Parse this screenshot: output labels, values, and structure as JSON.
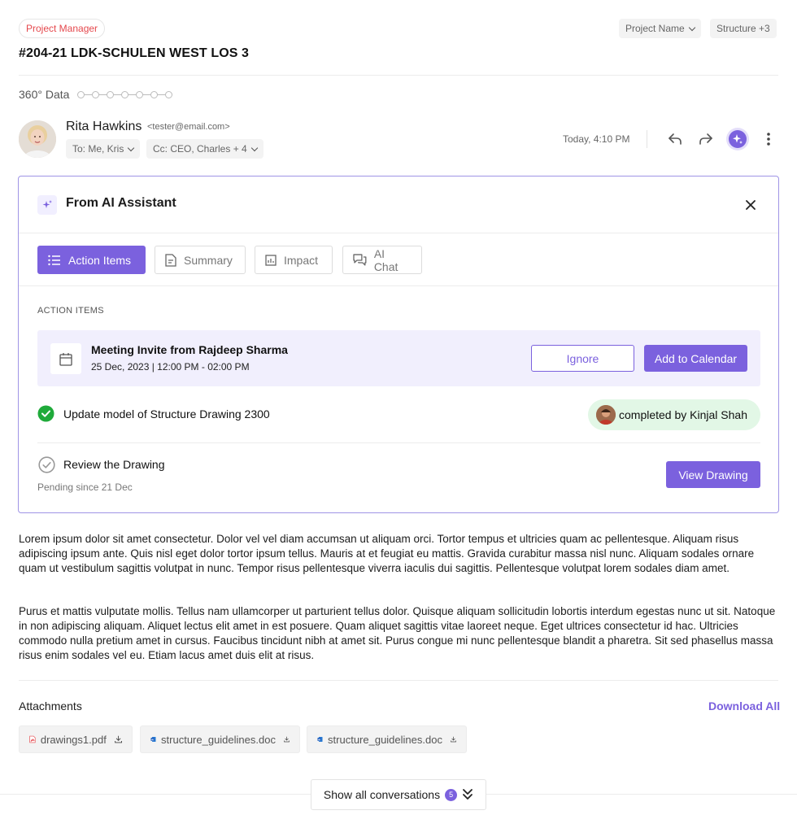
{
  "header": {
    "role_badge": "Project Manager",
    "project_name_chip": "Project Name",
    "structure_chip": "Structure +3",
    "title": "#204-21 LDK-SCHULEN WEST LOS 3",
    "data360_label": "360° Data"
  },
  "email": {
    "sender_name": "Rita Hawkins",
    "sender_email": "<tester@email.com>",
    "to_label": "To: Me, Kris",
    "cc_label": "Cc: CEO, Charles + 4",
    "timestamp": "Today, 4:10 PM",
    "icons": [
      "reply-icon",
      "forward-icon",
      "ai-sparkle-icon",
      "more-vertical-icon"
    ]
  },
  "ai_panel": {
    "title": "From AI Assistant",
    "tabs": [
      {
        "label": "Action Items",
        "icon": "list-icon",
        "active": true
      },
      {
        "label": "Summary",
        "icon": "document-icon",
        "active": false
      },
      {
        "label": "Impact",
        "icon": "chart-icon",
        "active": false
      },
      {
        "label": "AI Chat",
        "icon": "chat-icon",
        "active": false
      }
    ],
    "section_label": "ACTION ITEMS",
    "meeting": {
      "title": "Meeting Invite from Rajdeep Sharma",
      "time": "25 Dec, 2023 | 12:00 PM - 02:00 PM",
      "ignore_label": "Ignore",
      "add_label": "Add to Calendar"
    },
    "completed_item": {
      "text": "Update model of Structure Drawing 2300",
      "status": "completed by Kinjal Shah"
    },
    "pending_item": {
      "text": "Review the Drawing",
      "pending": "Pending since 21 Dec",
      "button": "View Drawing"
    }
  },
  "body": {
    "paragraph1": "Lorem ipsum dolor sit amet consectetur. Dolor vel vel diam accumsan ut aliquam orci. Tortor tempus et ultricies quam ac pellentesque. Aliquam risus adipiscing ipsum ante. Quis nisl eget dolor tortor ipsum tellus. Mauris at et feugiat eu mattis. Gravida curabitur massa nisl nunc. Aliquam sodales ornare quam ut vestibulum sagittis volutpat in nunc. Tempor risus pellentesque viverra iaculis dui sagittis. Pellentesque volutpat lorem sodales diam amet.",
    "paragraph2": "Purus et mattis vulputate mollis. Tellus nam ullamcorper ut parturient tellus dolor. Quisque aliquam sollicitudin lobortis interdum egestas nunc ut sit. Natoque in non adipiscing aliquam. Aliquet lectus elit amet in est posuere. Quam aliquet sagittis vitae laoreet neque. Eget ultrices consectetur id hac. Ultricies commodo nulla pretium amet in cursus. Faucibus tincidunt nibh at amet sit. Purus congue mi nunc pellentesque blandit a pharetra. Sit sed phasellus massa risus enim sodales vel eu. Etiam lacus amet duis elit at risus."
  },
  "attachments": {
    "title": "Attachments",
    "download_all": "Download All",
    "files": [
      {
        "name": "drawings1.pdf",
        "type": "pdf-icon"
      },
      {
        "name": "structure_guidelines.doc",
        "type": "word-icon"
      },
      {
        "name": "structure_guidelines.doc",
        "type": "word-icon"
      }
    ]
  },
  "footer": {
    "show_all_label": "Show all conversations",
    "count": "5"
  },
  "colors": {
    "accent": "#7b61de",
    "role_badge": "#e5484d",
    "completed_bg": "#e2f7e6",
    "check_green": "#1faa3a"
  }
}
